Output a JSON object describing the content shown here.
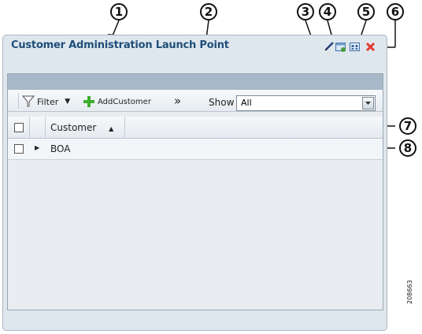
{
  "portlet": {
    "title": "Customer Administration Launch Point"
  },
  "toolbar": {
    "filter_label": "Filter",
    "add_label": "AddCustomer",
    "more_label": "»",
    "show_label": "Show",
    "show_value": "All"
  },
  "grid": {
    "columns": [
      "Customer"
    ],
    "rows": [
      {
        "customer": "BOA"
      }
    ]
  },
  "callouts": [
    "1",
    "2",
    "3",
    "4",
    "5",
    "6",
    "7",
    "8"
  ],
  "figure_id": "208663",
  "colors": {
    "title": "#1f4e79",
    "close_icon": "#e23b2e",
    "add_icon": "#3fae2a"
  }
}
